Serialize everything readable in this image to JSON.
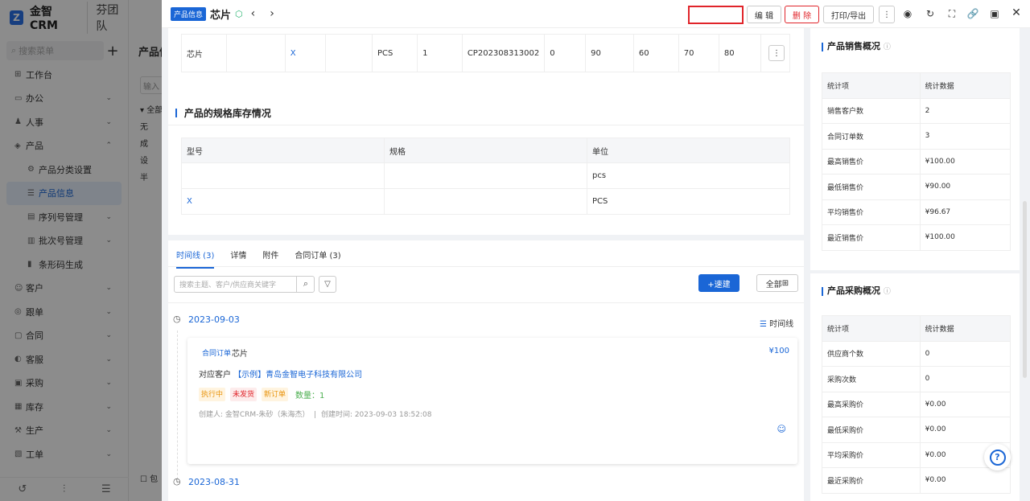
{
  "app": {
    "name": "金智CRM",
    "team": "芬团队",
    "menu_search_placeholder": "搜索菜单"
  },
  "menu": {
    "items": [
      {
        "label": "工作台",
        "icon": "dashboard-icon",
        "has_arrow": false
      },
      {
        "label": "办公",
        "icon": "office-icon",
        "has_arrow": true
      },
      {
        "label": "人事",
        "icon": "people-icon",
        "has_arrow": true
      },
      {
        "label": "产品",
        "icon": "product-icon",
        "has_arrow": true,
        "expanded": true
      }
    ],
    "sub_items": [
      {
        "label": "产品分类设置",
        "icon": "gear-icon"
      },
      {
        "label": "产品信息",
        "icon": "list-icon",
        "active": true
      },
      {
        "label": "序列号管理",
        "icon": "serial-icon",
        "has_arrow": true
      },
      {
        "label": "批次号管理",
        "icon": "batch-icon",
        "has_arrow": true
      },
      {
        "label": "条形码生成",
        "icon": "barcode-icon"
      }
    ],
    "items2": [
      {
        "label": "客户",
        "icon": "customer-icon"
      },
      {
        "label": "跟单",
        "icon": "follow-icon"
      },
      {
        "label": "合同",
        "icon": "contract-icon"
      },
      {
        "label": "客服",
        "icon": "service-icon"
      },
      {
        "label": "采购",
        "icon": "purchase-icon"
      },
      {
        "label": "库存",
        "icon": "stock-icon"
      },
      {
        "label": "生产",
        "icon": "production-icon"
      },
      {
        "label": "工单",
        "icon": "ticket-icon"
      }
    ]
  },
  "bg_page": {
    "title": "产品信",
    "input_placeholder": "输入",
    "tree": [
      "▾ 全部",
      "无",
      "成",
      "设",
      "半"
    ],
    "checkbox_label": "包"
  },
  "drawer": {
    "badge": "产品信息",
    "title": "芯片",
    "buttons": {
      "edit": "编 辑",
      "delete": "删 除",
      "print": "打印/导出"
    }
  },
  "product_row": [
    "芯片",
    "",
    "X",
    "",
    "PCS",
    "1",
    "CP202308313002",
    "0",
    "90",
    "60",
    "70",
    "80"
  ],
  "spec_section": {
    "title": "产品的规格库存情况",
    "headers": [
      "型号",
      "规格",
      "单位"
    ],
    "rows": [
      [
        "",
        "",
        "pcs"
      ],
      [
        "X",
        "",
        "PCS"
      ]
    ]
  },
  "tabs": [
    "时间线 (3)",
    "详情",
    "附件",
    "合同订单 (3)"
  ],
  "timeline": {
    "search_placeholder": "搜索主题、客户/供应商关键字",
    "quick_create": "+速建",
    "all_label": "全部",
    "timeline_link": "时间线",
    "dates": [
      "2023-09-03",
      "2023-08-31"
    ],
    "entry": {
      "type_tag": "合同订单",
      "name": "芯片",
      "price": "¥100",
      "customer_prefix": "对应客户",
      "customer": "【示例】青岛金智电子科技有限公司",
      "tags": [
        "执行中",
        "未发货",
        "新订单"
      ],
      "quantity": "数量：1",
      "creator": "创建人: 金智CRM-朱砂（朱海杰）",
      "created": "创建时间: 2023-09-03 18:52:08"
    }
  },
  "sales": {
    "title": "产品销售概况",
    "headers": [
      "统计项",
      "统计数据"
    ],
    "rows": [
      [
        "销售客户数",
        "2"
      ],
      [
        "合同订单数",
        "3"
      ],
      [
        "最高销售价",
        "¥100.00"
      ],
      [
        "最低销售价",
        "¥90.00"
      ],
      [
        "平均销售价",
        "¥96.67"
      ],
      [
        "最近销售价",
        "¥100.00"
      ]
    ]
  },
  "purchase": {
    "title": "产品采购概况",
    "headers": [
      "统计项",
      "统计数据"
    ],
    "rows": [
      [
        "供应商个数",
        "0"
      ],
      [
        "采购次数",
        "0"
      ],
      [
        "最高采购价",
        "¥0.00"
      ],
      [
        "最低采购价",
        "¥0.00"
      ],
      [
        "平均采购价",
        "¥0.00"
      ],
      [
        "最近采购价",
        "¥0.00"
      ]
    ]
  },
  "colors": {
    "accent": "#1a66d6",
    "danger": "#e0242a",
    "success": "#2bb673"
  }
}
